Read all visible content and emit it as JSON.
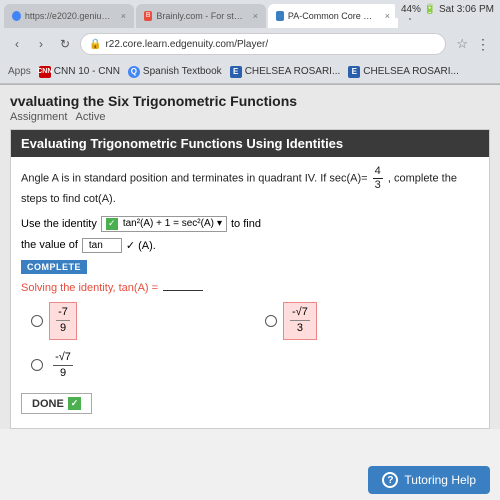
{
  "browser": {
    "tabs": [
      {
        "id": "tab1",
        "label": "https://e2020.geniussis...",
        "active": false,
        "icon": "🔵"
      },
      {
        "id": "tab2",
        "label": "Brainly.com - For studen...",
        "active": false,
        "icon": "📝"
      },
      {
        "id": "tab3",
        "label": "PA-Common Core Geome...",
        "active": true,
        "icon": "📄"
      },
      {
        "id": "tab-add",
        "label": "+",
        "active": false,
        "icon": ""
      }
    ],
    "url": "r22.core.learn.edgenuity.com/Player/",
    "bookmarks": [
      {
        "label": "CNN 10 - CNN",
        "icon": "CNN",
        "iconClass": "cnn-icon"
      },
      {
        "label": "Spanish Textbook",
        "icon": "P",
        "iconClass": "search-icon-bm"
      },
      {
        "label": "CHELSEA ROSARI...",
        "icon": "E",
        "iconClass": "chelsea-icon"
      },
      {
        "label": "CHELSEA ROSARI...",
        "icon": "E",
        "iconClass": "chelsea-icon"
      }
    ],
    "status": "44% 🔋 Sat 3:06 PM"
  },
  "page": {
    "title": "valuating the Six Trigonometric Functions",
    "assignment_label": "Assignment",
    "status": "Active"
  },
  "section": {
    "heading": "Evaluating Trigonometric Functions Using Identities",
    "problem_text_1": "Angle A is in standard position and terminates in quadrant IV. If sec(A)=",
    "fraction_num": "4",
    "fraction_den": "3",
    "problem_text_2": ", complete the steps to find cot(A).",
    "identity_prefix": "Use the identity",
    "identity_dropdown": "tan²(A) + 1 = sec²(A)",
    "identity_suffix": "to find",
    "value_label": "the value of",
    "value_input": "tan",
    "check_label": "✓ (A).",
    "complete_btn": "COMPLETE",
    "solving_label": "Solving the identity, tan(A) =",
    "blank": "____.",
    "answers": [
      {
        "id": "a1",
        "num": "-7",
        "den": "9",
        "highlighted": true
      },
      {
        "id": "a2",
        "num": "-√7",
        "den": "3",
        "highlighted": true
      },
      {
        "id": "a3",
        "num": "-√7",
        "den": "9",
        "highlighted": false
      }
    ],
    "done_label": "DONE",
    "check_mark": "✓"
  },
  "footer": {
    "tutoring_icon": "?",
    "tutoring_label": "Tutoring Help"
  }
}
